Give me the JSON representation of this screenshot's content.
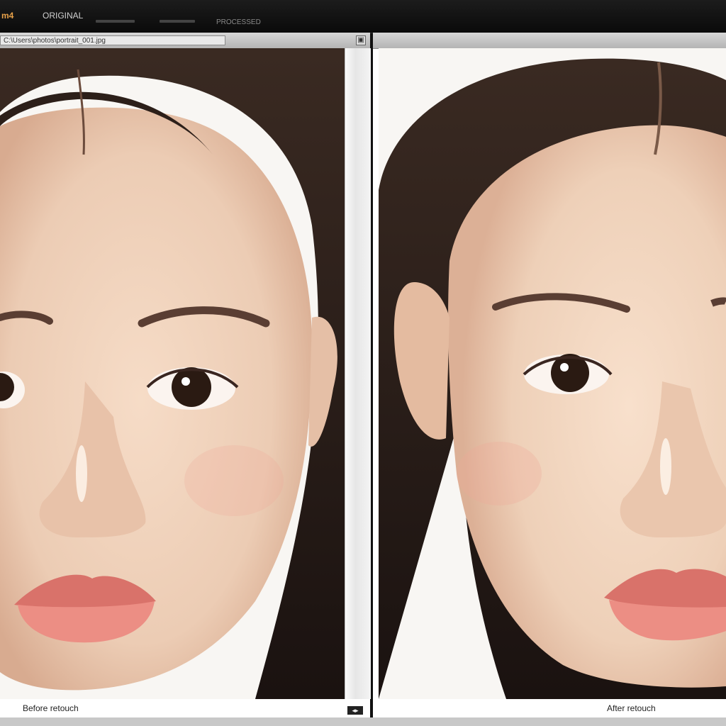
{
  "toolbar": {
    "logo_text": "m4",
    "menu_label": "ORIGINAL",
    "right_label": "PROCESSED",
    "window_icon": "window-icon"
  },
  "left_panel": {
    "path_text": "C:\\Users\\photos\\portrait_001.jpg",
    "caption": "Before retouch",
    "corner_icon": "▣"
  },
  "right_panel": {
    "caption": "After retouch"
  },
  "scroll": {
    "grip_label": "◂▸"
  },
  "colors": {
    "skin": "#efd3bd",
    "hair": "#2a1d18",
    "lip": "#e48a80",
    "panel_bg": "#ffffff"
  }
}
